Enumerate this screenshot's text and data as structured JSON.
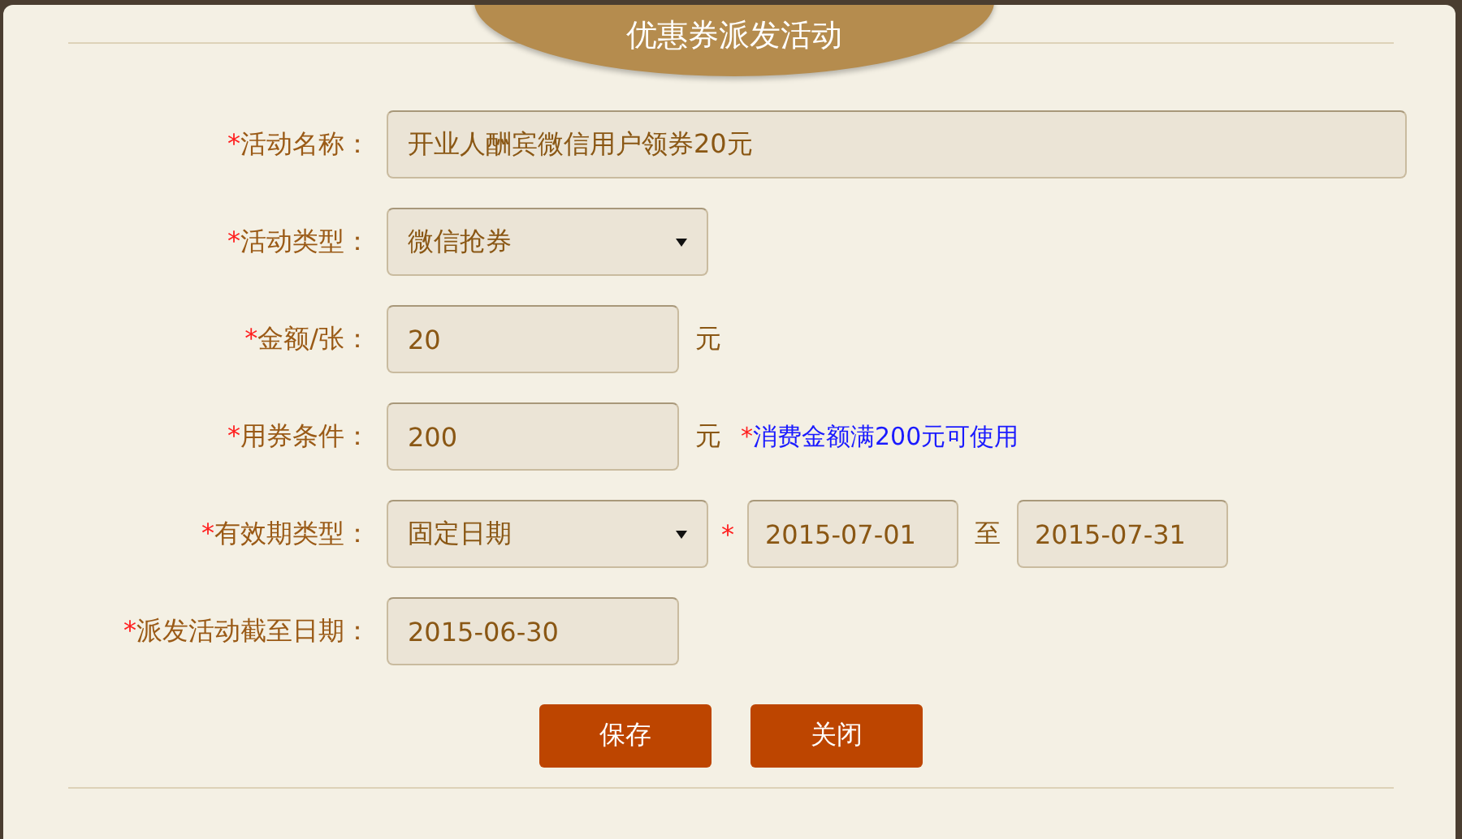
{
  "dialog": {
    "title": "优惠券派发活动",
    "rows": [
      {
        "required": "*",
        "label": "活动名称：",
        "controls": [
          {
            "kind": "wide_input",
            "value": "开业人酬宾微信用户领券20元"
          }
        ]
      },
      {
        "required": "*",
        "label": "活动类型：",
        "controls": [
          {
            "kind": "select",
            "value": "微信抢券"
          }
        ]
      },
      {
        "required": "*",
        "label": "金额/张：",
        "controls": [
          {
            "kind": "input",
            "value": "20"
          },
          {
            "kind": "unit",
            "text": "元"
          }
        ]
      },
      {
        "required": "*",
        "label": "用券条件：",
        "controls": [
          {
            "kind": "input",
            "value": "200"
          },
          {
            "kind": "unit",
            "text": "元"
          },
          {
            "kind": "note",
            "mark": "*",
            "text": "消费金额满200元可使用"
          }
        ]
      },
      {
        "required": "*",
        "label": "有效期类型：",
        "controls": [
          {
            "kind": "select",
            "value": "固定日期"
          },
          {
            "kind": "mark",
            "text": "*"
          },
          {
            "kind": "range_input",
            "value": "2015-07-01"
          },
          {
            "kind": "unit",
            "text": "至"
          },
          {
            "kind": "range_input",
            "value": "2015-07-31"
          }
        ]
      },
      {
        "required": "*",
        "label": "派发活动截至日期：",
        "controls": [
          {
            "kind": "input",
            "value": "2015-06-30"
          }
        ]
      }
    ],
    "buttons": [
      {
        "label": "保存"
      },
      {
        "label": "关闭"
      }
    ]
  }
}
